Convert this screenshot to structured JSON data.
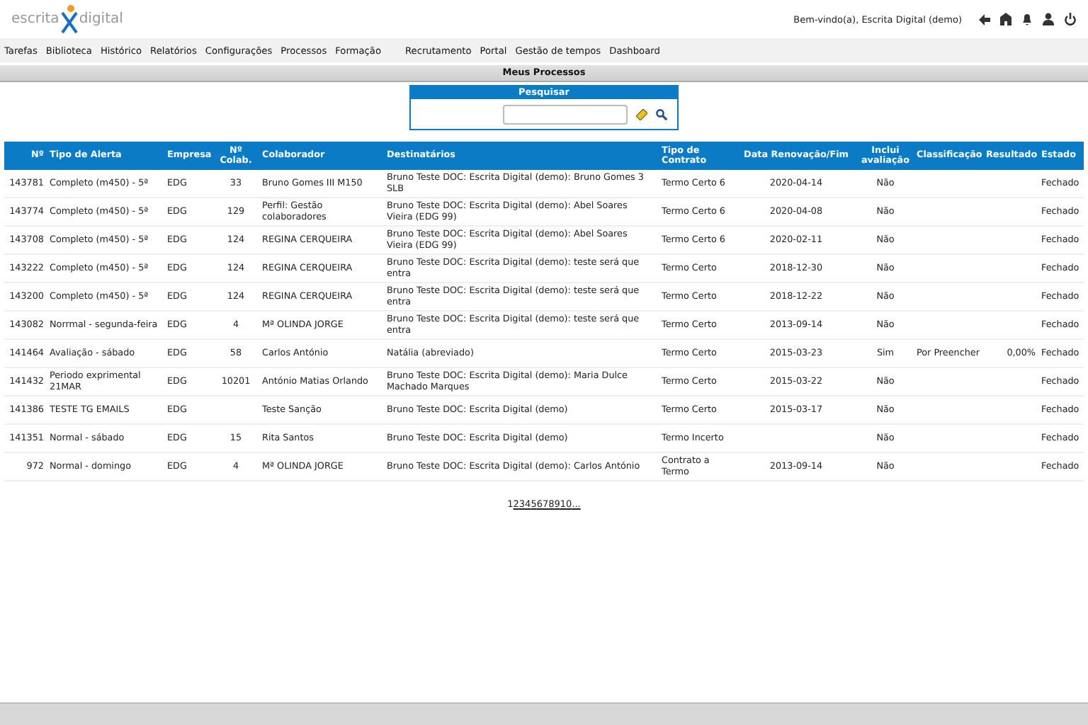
{
  "header": {
    "logo_left": "escrita",
    "logo_right": "digital",
    "welcome": "Bem-vindo(a),",
    "user": "Escrita Digital (demo)"
  },
  "menu": [
    "Tarefas",
    "Biblioteca",
    "Histórico",
    "Relatórios",
    "Configurações",
    "Processos",
    "Formação",
    "Recrutamento",
    "Portal",
    "Gestão de tempos",
    "Dashboard"
  ],
  "page_title": "Meus Processos",
  "search": {
    "title": "Pesquisar"
  },
  "table": {
    "columns": [
      "Nº",
      "Tipo de Alerta",
      "Empresa",
      "Nº Colab.",
      "Colaborador",
      "Destinatários",
      "Tipo de Contrato",
      "Data Renovação/Fim",
      "Inclui avaliação",
      "Classificação",
      "Resultado",
      "Estado"
    ],
    "rows": [
      {
        "cells": [
          "143781",
          "Completo (m450) - 5ª",
          "EDG",
          "33",
          "Bruno Gomes III M150",
          "Bruno Teste DOC: Escrita Digital (demo): Bruno Gomes 3 SLB",
          "Termo Certo 6",
          "2020-04-14",
          "Não",
          null,
          null,
          "Fechado"
        ]
      },
      {
        "cells": [
          "143774",
          "Completo (m450) - 5ª",
          "EDG",
          "129",
          "Perfil: Gestão colaboradores",
          "Bruno Teste DOC: Escrita Digital (demo): Abel Soares Vieira (EDG 99)",
          "Termo Certo 6",
          "2020-04-08",
          "Não",
          null,
          null,
          "Fechado"
        ]
      },
      {
        "cells": [
          "143708",
          "Completo (m450) - 5ª",
          "EDG",
          "124",
          "REGINA CERQUEIRA",
          "Bruno Teste DOC: Escrita Digital (demo): Abel Soares Vieira (EDG 99)",
          "Termo Certo 6",
          "2020-02-11",
          "Não",
          null,
          null,
          "Fechado"
        ]
      },
      {
        "cells": [
          "143222",
          "Completo (m450) - 5ª",
          "EDG",
          "124",
          "REGINA CERQUEIRA",
          "Bruno Teste DOC: Escrita Digital (demo): teste será que entra",
          "Termo Certo",
          "2018-12-30",
          "Não",
          null,
          null,
          "Fechado"
        ]
      },
      {
        "cells": [
          "143200",
          "Completo (m450) - 5ª",
          "EDG",
          "124",
          "REGINA CERQUEIRA",
          "Bruno Teste DOC: Escrita Digital (demo): teste será que entra",
          "Termo Certo",
          "2018-12-22",
          "Não",
          null,
          null,
          "Fechado"
        ]
      },
      {
        "cells": [
          "143082",
          "Norrmal - segunda-feira",
          "EDG",
          "4",
          "Mª OLINDA JORGE",
          "Bruno Teste DOC: Escrita Digital (demo): teste será que entra",
          "Termo Certo",
          "2013-09-14",
          "Não",
          null,
          null,
          "Fechado"
        ]
      },
      {
        "cells": [
          "141464",
          "Avaliação - sábado",
          "EDG",
          "58",
          "Carlos António",
          "Natália (abreviado)",
          "Termo Certo",
          "2015-03-23",
          "Sim",
          "Por Preencher",
          "0,00%",
          "Fechado"
        ]
      },
      {
        "cells": [
          "141432",
          "Periodo exprimental 21MAR",
          "EDG",
          "10201",
          "António Matias Orlando",
          "Bruno Teste DOC: Escrita Digital (demo): Maria Dulce Machado Marques",
          "Termo Certo",
          "2015-03-22",
          "Não",
          null,
          null,
          "Fechado"
        ]
      },
      {
        "cells": [
          "141386",
          "TESTE TG EMAILS",
          "EDG",
          null,
          "Teste Sanção",
          "Bruno Teste DOC: Escrita Digital (demo)",
          "Termo Certo",
          "2015-03-17",
          "Não",
          null,
          null,
          "Fechado"
        ]
      },
      {
        "cells": [
          "141351",
          "Normal - sábado",
          "EDG",
          "15",
          "Rita Santos",
          "Bruno Teste DOC: Escrita Digital (demo)",
          "Termo Incerto",
          null,
          "Não",
          null,
          null,
          "Fechado"
        ]
      },
      {
        "cells": [
          "972",
          "Normal - domingo",
          "EDG",
          "4",
          "Mª OLINDA JORGE",
          "Bruno Teste DOC: Escrita Digital (demo): Carlos António",
          "Contrato a Termo",
          "2013-09-14",
          "Não",
          null,
          null,
          "Fechado"
        ]
      }
    ]
  },
  "pagination": [
    {
      "label": "1",
      "selected": true
    },
    {
      "label": "2",
      "selected": false
    },
    {
      "label": "3",
      "selected": false
    },
    {
      "label": "4",
      "selected": false
    },
    {
      "label": "5",
      "selected": false
    },
    {
      "label": "6",
      "selected": false
    },
    {
      "label": "7",
      "selected": false
    },
    {
      "label": "8",
      "selected": false
    },
    {
      "label": "9",
      "selected": false
    },
    {
      "label": "10",
      "selected": false
    },
    {
      "label": "...",
      "selected": false
    }
  ]
}
